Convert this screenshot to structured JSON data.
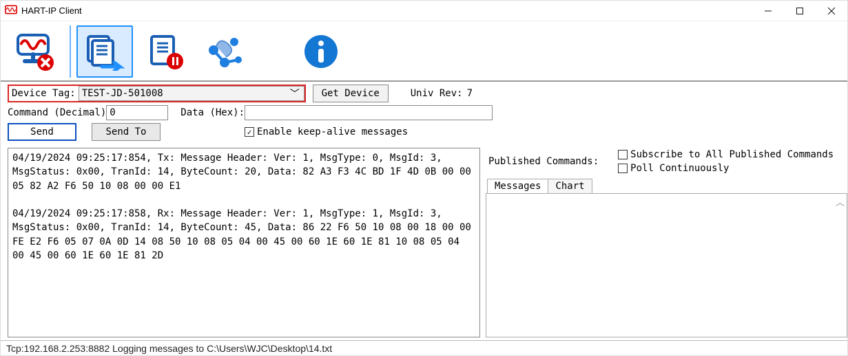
{
  "window": {
    "title": "HART-IP Client"
  },
  "form": {
    "device_tag_label": "Device Tag:",
    "device_tag_value": "TEST-JD-501008",
    "get_device_label": "Get Device",
    "univ_rev_label": "Univ Rev:",
    "univ_rev_value": "7",
    "command_label": "Command (Decimal)",
    "command_value": "0",
    "data_label": "Data (Hex):",
    "data_value": "",
    "send_label": "Send",
    "send_to_label": "Send To",
    "enable_keepalive_label": "Enable keep-alive messages",
    "enable_keepalive_checked": true
  },
  "published": {
    "header": "Published Commands:",
    "subscribe_label": "Subscribe to All Published Commands",
    "subscribe_checked": false,
    "poll_label": "Poll Continuously",
    "poll_checked": false,
    "tabs": {
      "messages": "Messages",
      "chart": "Chart"
    }
  },
  "log": {
    "entry1": "04/19/2024 09:25:17:854, Tx: Message Header: Ver: 1, MsgType: 0, MsgId: 3, MsgStatus: 0x00, TranId: 14, ByteCount: 20, Data: 82 A3 F3 4C BD 1F 4D 0B 00 00 05 82 A2 F6 50 10 08 00 00 E1",
    "entry2": "04/19/2024 09:25:17:858, Rx: Message Header: Ver: 1, MsgType: 1, MsgId: 3, MsgStatus: 0x00, TranId: 14, ByteCount: 45, Data: 86 22 F6 50 10 08 00 18 00 00 FE E2 F6 05 07 0A 0D 14 08 50 10 08 05 04 00 45 00 60 1E 60 1E 81 10 08 05 04 00 45 00 60 1E 60 1E 81 2D"
  },
  "status": {
    "text": "Tcp:192.168.2.253:8882  Logging messages to C:\\Users\\WJC\\Desktop\\14.txt"
  }
}
